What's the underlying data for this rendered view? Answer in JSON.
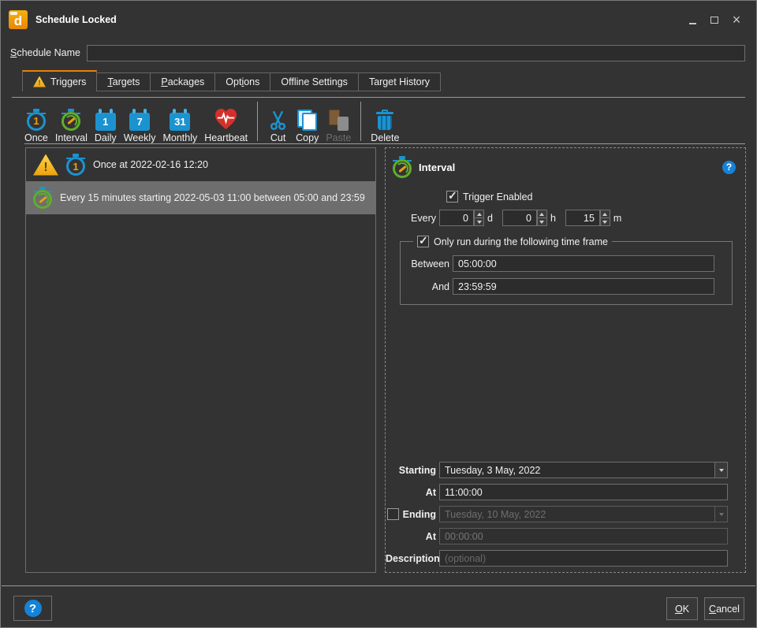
{
  "window": {
    "title": "Schedule Locked",
    "app_letter": "d"
  },
  "schedule_name": {
    "key": "S",
    "post": "chedule Name",
    "value": ""
  },
  "tabs": {
    "triggers": {
      "label": "Triggers"
    },
    "targets": {
      "key": "T",
      "post": "argets"
    },
    "packages": {
      "key": "P",
      "post": "ackages"
    },
    "options": {
      "pre": "Opt",
      "key": "i",
      "post": "ons"
    },
    "offline": {
      "label": "Offline Settings"
    },
    "history": {
      "label": "Target History"
    }
  },
  "toolbar": {
    "once": {
      "label": "Once",
      "num": "1"
    },
    "interval": {
      "label": "Interval"
    },
    "daily": {
      "label": "Daily",
      "num": "1"
    },
    "weekly": {
      "label": "Weekly",
      "num": "7"
    },
    "monthly": {
      "label": "Monthly",
      "num": "31"
    },
    "heartbeat": {
      "label": "Heartbeat"
    },
    "cut": {
      "label": "Cut"
    },
    "copy": {
      "label": "Copy"
    },
    "paste": {
      "label": "Paste"
    },
    "delete": {
      "label": "Delete"
    }
  },
  "trigger_list": {
    "item1": {
      "text": "Once at 2022-02-16 12:20",
      "num": "1"
    },
    "item2": {
      "text": "Every 15 minutes starting 2022-05-03 11:00 between 05:00 and 23:59"
    }
  },
  "detail": {
    "title": "Interval",
    "help": "?",
    "trigger_enabled": "Trigger Enabled",
    "every": {
      "label": "Every",
      "days": "0",
      "d": "d",
      "hours": "0",
      "h": "h",
      "minutes": "15",
      "m": "m"
    },
    "time_frame": {
      "label": "Only run during the following time frame",
      "between_label": "Between",
      "between_value": "05:00:00",
      "and_label": "And",
      "and_value": "23:59:59"
    },
    "starting": {
      "label": "Starting",
      "value": "Tuesday, 3 May, 2022"
    },
    "starting_at": {
      "label": "At",
      "value": "11:00:00"
    },
    "ending": {
      "label": "Ending",
      "value": "Tuesday, 10 May, 2022"
    },
    "ending_at": {
      "label": "At",
      "value": "00:00:00"
    },
    "description": {
      "label": "Description",
      "placeholder": "(optional)"
    }
  },
  "footer": {
    "help": "?",
    "ok": {
      "key": "O",
      "post": "K"
    },
    "cancel": {
      "key": "C",
      "post": "ancel"
    }
  },
  "colors": {
    "accent_orange": "#e8830c",
    "icon_blue": "#1b93d0",
    "icon_green": "#5fae2b",
    "warning_yellow": "#f6b91e",
    "heart_red": "#d6302c",
    "selection_gray": "#6e6e6e",
    "help_blue": "#1583d7",
    "background": "#333333"
  }
}
